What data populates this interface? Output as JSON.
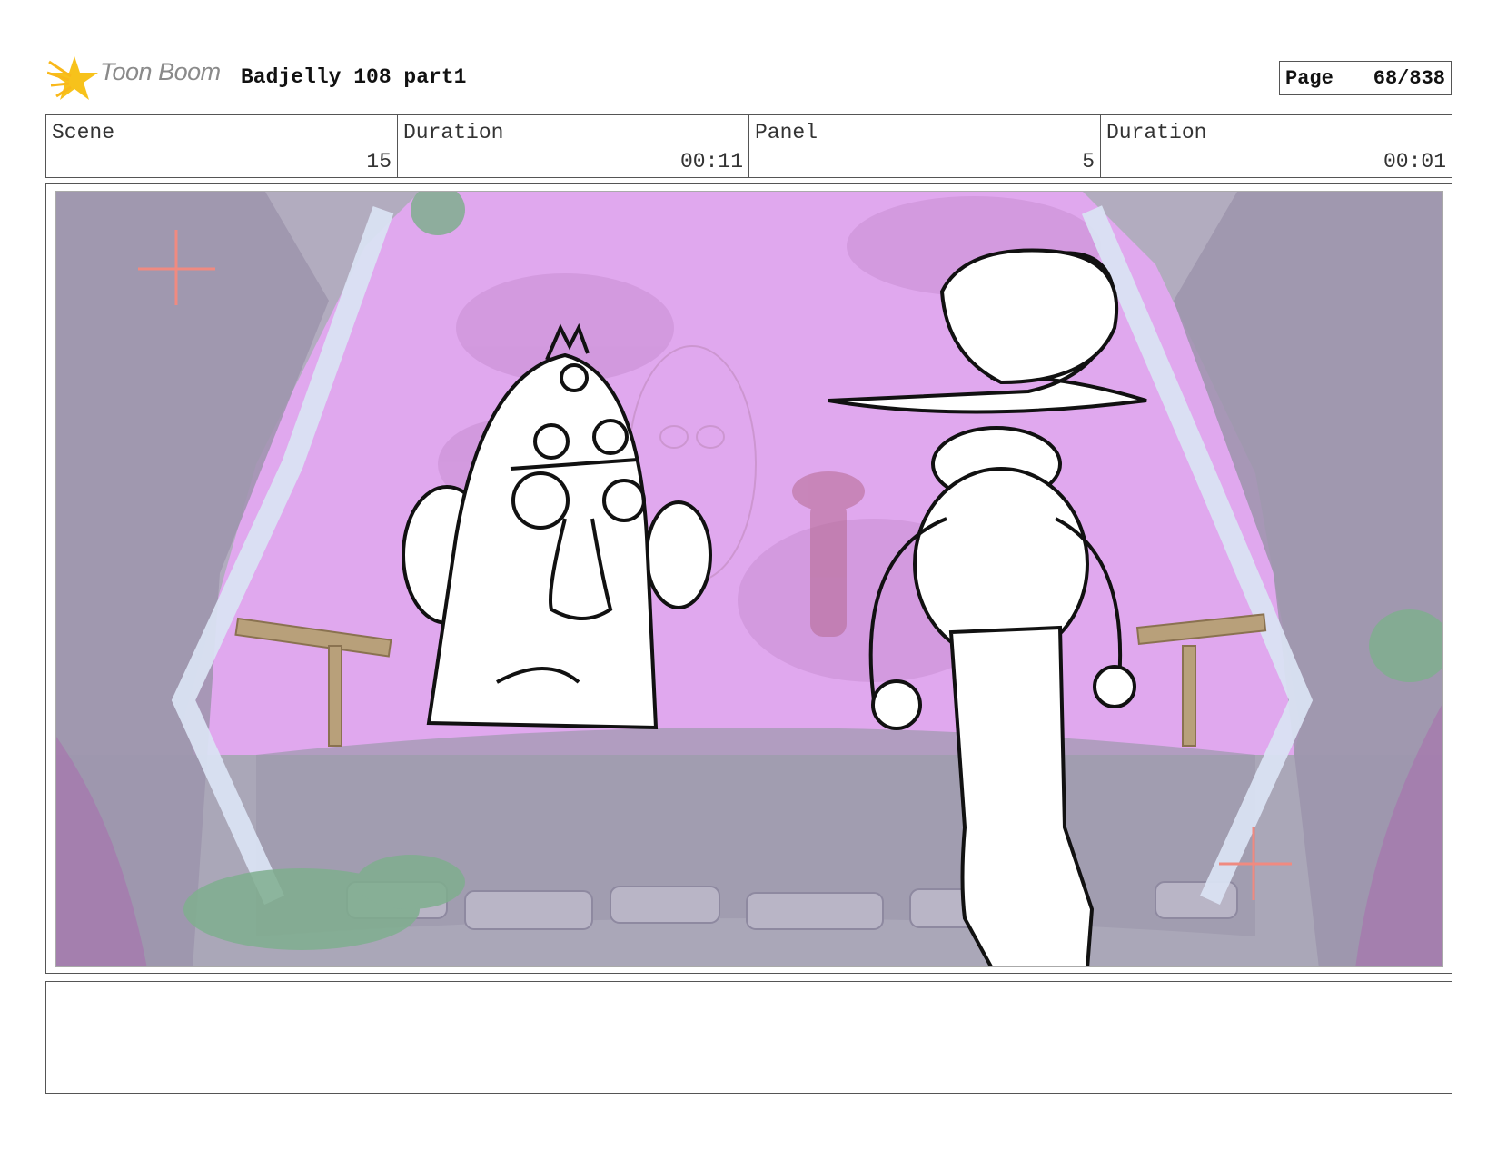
{
  "header": {
    "logo_text": "Toon Boom",
    "title": "Badjelly 108 part1",
    "page_label": "Page",
    "page_value": "68/838"
  },
  "info": {
    "scene_label": "Scene",
    "scene_value": "15",
    "scene_duration_label": "Duration",
    "scene_duration_value": "00:11",
    "panel_label": "Panel",
    "panel_value": "5",
    "panel_duration_label": "Duration",
    "panel_duration_value": "00:01"
  },
  "notes": {
    "text": ""
  },
  "colors": {
    "sky": "#e0a8ee",
    "ground": "#a9a6b6",
    "stone": "#9b93ad",
    "frame_glass": "#d9e2f2",
    "safe_marker": "#f08a80",
    "logo_star": "#f7c21b"
  },
  "icons": {
    "logo": "toon-boom-star-logo",
    "safe_marker": "crosshair-marker"
  }
}
